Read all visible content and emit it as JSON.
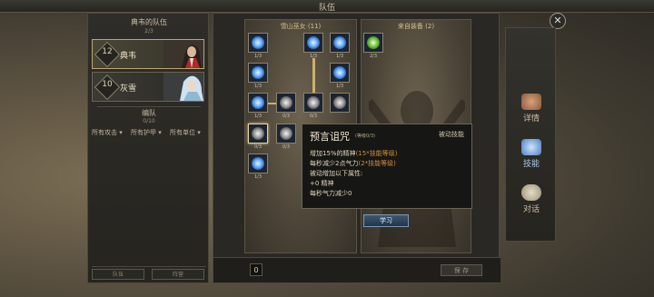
{
  "window": {
    "title": "队伍",
    "close_icon": "close-icon"
  },
  "left_panel": {
    "title": "典韦的队伍",
    "count": "2/3",
    "members": [
      {
        "level": "12",
        "name": "典韦",
        "selected": true
      },
      {
        "level": "10",
        "name": "灰雪",
        "selected": false
      }
    ],
    "formation_title": "编队",
    "formation_count": "0/10",
    "filters": [
      "所有攻击",
      "所有护甲",
      "所有单位"
    ],
    "bottom_buttons": [
      "队伍",
      "阵营"
    ]
  },
  "skill_tree": {
    "title": "雪山巫女 (11)",
    "skills": [
      {
        "label": "1/3",
        "icon": "ice-crystal-icon",
        "style": "sk-blue"
      },
      {
        "label": "1/3",
        "icon": "frost-orb-icon",
        "style": "sk-blue"
      },
      {
        "label": "1/3",
        "icon": "snow-shard-icon",
        "style": "sk-blue"
      },
      {
        "label": "1/3",
        "icon": "whirl-icon",
        "style": "sk-blue"
      },
      {
        "label": "1/3",
        "icon": "frost-burst-icon",
        "style": "sk-blue"
      },
      {
        "label": "1/3",
        "icon": "snowflake-icon",
        "style": "sk-blue"
      },
      {
        "label": "0/3",
        "icon": "light-burst-icon",
        "style": "sk-grey"
      },
      {
        "label": "0/3",
        "icon": "vortex-icon",
        "style": "sk-grey"
      },
      {
        "label": "",
        "icon": "spiral-icon",
        "style": "sk-grey"
      },
      {
        "label": "0/3",
        "icon": "prophecy-curse-icon",
        "style": "sk-grey"
      },
      {
        "label": "0/3",
        "icon": "grey-orb-icon",
        "style": "sk-grey"
      },
      {
        "label": "1/3",
        "icon": "ice-spikes-icon",
        "style": "sk-blue"
      }
    ]
  },
  "equipment": {
    "title": "来自装备 (2)",
    "skills": [
      {
        "label": "2/3",
        "icon": "green-aura-icon",
        "style": "sk-green"
      }
    ]
  },
  "tooltip": {
    "name": "预言诅咒",
    "level": "(等级0/3)",
    "type": "被动技能",
    "lines": [
      {
        "text": "增加15%的精神",
        "note": "(15*技能等级)"
      },
      {
        "text": "每秒减少2点气力",
        "note": "(2*技能等级)"
      },
      {
        "text": "被动增加以下属性:",
        "note": ""
      },
      {
        "text": "+0 精神",
        "note": ""
      },
      {
        "text": "每秒气力减少0",
        "note": ""
      }
    ],
    "learn_button": "学习"
  },
  "bottom": {
    "points": "0",
    "save_button": "保 存"
  },
  "side_menu": [
    {
      "label": "详情",
      "icon": "fist-icon",
      "active": false
    },
    {
      "label": "技能",
      "icon": "skill-book-icon",
      "active": true
    },
    {
      "label": "对话",
      "icon": "speech-bubble-icon",
      "active": false
    }
  ],
  "colors": {
    "accent_gold": "#d5c08a",
    "learn_blue": "#3d5770",
    "orange_note": "#d08d3a"
  }
}
